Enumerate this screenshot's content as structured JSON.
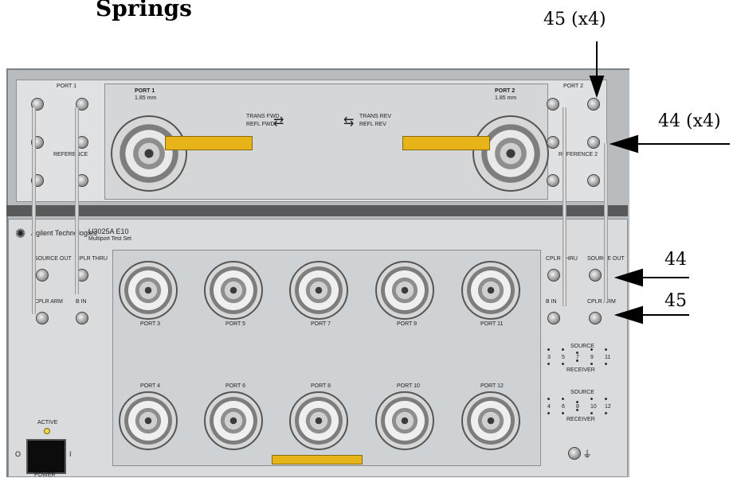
{
  "figure": {
    "heading": "Springs",
    "callouts": {
      "top": "45 (x4)",
      "right_upper": "44 (x4)",
      "right_mid": "44",
      "right_low": "45"
    }
  },
  "panel_top": {
    "port1_title": "PORT 1",
    "port1_sub": "1.85 mm",
    "port2_title": "PORT 2",
    "port2_sub": "1.85 mm",
    "port1_block_label": "PORT 1",
    "port2_block_label": "PORT 2",
    "reference1_label": "REFERENCE",
    "reference2_label": "REFERENCE 2",
    "trans_fwd": "TRANS FWD",
    "refl_fwd": "REFL FWD",
    "trans_rev": "TRANS REV",
    "refl_rev": "REFL REV"
  },
  "panel_bottom": {
    "brand": "Agilent Technologies",
    "model": "U3025A E10",
    "model_sub": "Multiport Test Set",
    "left_ports": [
      "SOURCE OUT",
      "CPLR THRU",
      "CPLR ARM",
      "B IN"
    ],
    "right_ports": [
      "CPLR THRU",
      "SOURCE OUT",
      "B IN",
      "CPLR ARM"
    ],
    "port_row_top": [
      "PORT 3",
      "PORT 5",
      "PORT 7",
      "PORT 9",
      "PORT 11"
    ],
    "port_row_bottom": [
      "PORT 4",
      "PORT 6",
      "PORT 8",
      "PORT 10",
      "PORT 12"
    ],
    "matrix_top_title": "SOURCE",
    "matrix_top_cols": [
      "3",
      "5",
      "7",
      "9",
      "11"
    ],
    "matrix_top_footer": "RECEIVER",
    "matrix_bot_title": "SOURCE",
    "matrix_bot_cols": [
      "4",
      "6",
      "8",
      "10",
      "12"
    ],
    "matrix_bot_footer": "RECEIVER",
    "active_label": "ACTIVE",
    "power_label": "POWER",
    "power_off": "O",
    "power_on": "I"
  },
  "colors": {
    "warning_yellow": "#e6b418",
    "active_led": "#f2d24b",
    "panel": "#d9dbdd"
  }
}
